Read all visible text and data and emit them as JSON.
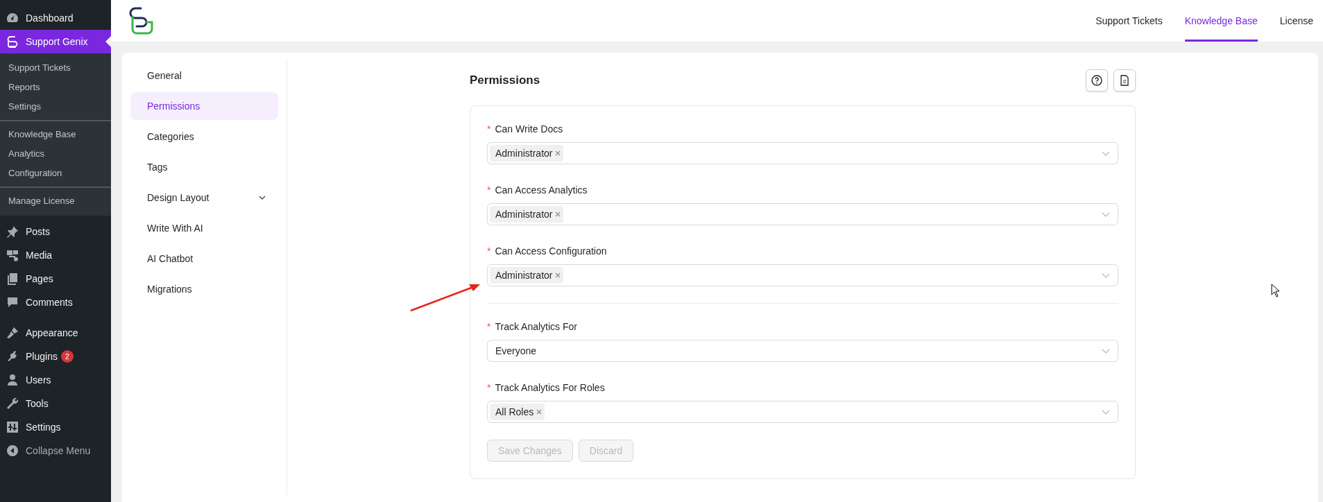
{
  "admin_menu": {
    "groups": [
      {
        "items": [
          {
            "label": "Dashboard",
            "selected": false
          },
          {
            "label": "Support Genix",
            "selected": true,
            "submenu": [
              [
                {
                  "label": "Support Tickets",
                  "selected": false
                },
                {
                  "label": "Reports",
                  "selected": false
                },
                {
                  "label": "Settings",
                  "selected": false
                }
              ],
              [
                {
                  "label": "Knowledge Base",
                  "selected": false
                },
                {
                  "label": "Analytics",
                  "selected": false
                },
                {
                  "label": "Configuration",
                  "selected": false
                }
              ],
              [
                {
                  "label": "Manage License",
                  "selected": false
                }
              ]
            ]
          }
        ]
      },
      {
        "items": [
          {
            "label": "Posts",
            "selected": false
          },
          {
            "label": "Media",
            "selected": false
          },
          {
            "label": "Pages",
            "selected": false
          },
          {
            "label": "Comments",
            "selected": false
          }
        ]
      },
      {
        "items": [
          {
            "label": "Appearance",
            "selected": false
          },
          {
            "label": "Plugins",
            "selected": false,
            "badge": "2"
          },
          {
            "label": "Users",
            "selected": false
          },
          {
            "label": "Tools",
            "selected": false
          },
          {
            "label": "Settings",
            "selected": false
          }
        ]
      }
    ],
    "collapse": {
      "label": "Collapse Menu"
    }
  },
  "header": {
    "tabs": [
      {
        "label": "Support Tickets",
        "selected": false
      },
      {
        "label": "Knowledge Base",
        "selected": true
      },
      {
        "label": "License",
        "selected": false
      }
    ]
  },
  "settings_nav": {
    "items": [
      {
        "label": "General",
        "kind": "link",
        "selected": false
      },
      {
        "label": "Permissions",
        "kind": "link",
        "selected": true
      },
      {
        "label": "Categories",
        "kind": "link",
        "selected": false
      },
      {
        "label": "Tags",
        "kind": "link",
        "selected": false
      },
      {
        "label": "Design Layout",
        "kind": "submenu",
        "selected": false
      },
      {
        "label": "Write With AI",
        "kind": "link",
        "selected": false
      },
      {
        "label": "AI Chatbot",
        "kind": "link",
        "selected": false
      },
      {
        "label": "Migrations",
        "kind": "link",
        "selected": false
      }
    ]
  },
  "main": {
    "title": "Permissions",
    "sections": [
      {
        "fields": [
          {
            "label": "Can Write Docs",
            "required_mark": "*",
            "kind": "multi",
            "tags": [
              "Administrator"
            ]
          },
          {
            "label": "Can Access Analytics",
            "required_mark": "*",
            "kind": "multi",
            "tags": [
              "Administrator"
            ]
          },
          {
            "label": "Can Access Configuration",
            "required_mark": "*",
            "kind": "multi",
            "tags": [
              "Administrator"
            ]
          }
        ]
      },
      {
        "fields": [
          {
            "label": "Track Analytics For",
            "required_mark": "*",
            "kind": "single",
            "value": "Everyone"
          },
          {
            "label": "Track Analytics For Roles",
            "required_mark": "*",
            "kind": "multi",
            "tags": [
              "All Roles"
            ]
          }
        ]
      }
    ],
    "buttons": [
      {
        "label": "Save Changes",
        "disabled": true
      },
      {
        "label": "Discard",
        "disabled": true
      }
    ]
  }
}
